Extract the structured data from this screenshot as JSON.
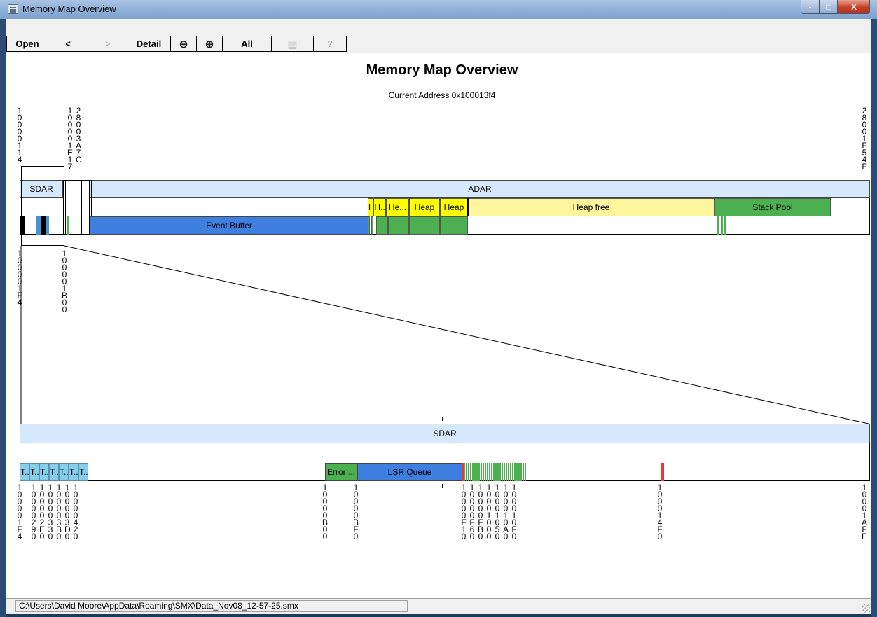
{
  "window": {
    "title": "Memory Map Overview",
    "controls": {
      "minimize": "-",
      "maximize": "□",
      "close": "X"
    }
  },
  "toolbar": {
    "buttons": [
      {
        "label": "Open",
        "icon": "",
        "enabled": true
      },
      {
        "label": "<",
        "icon": "",
        "enabled": true
      },
      {
        "label": ">",
        "icon": "",
        "enabled": false
      },
      {
        "label": "Detail",
        "icon": "",
        "enabled": true
      },
      {
        "label": "",
        "icon": "zoom-out-icon",
        "enabled": true
      },
      {
        "label": "",
        "icon": "zoom-in-icon",
        "enabled": true
      },
      {
        "label": "All",
        "icon": "",
        "enabled": true
      },
      {
        "label": "",
        "icon": "document-icon",
        "enabled": false
      },
      {
        "label": "?",
        "icon": "",
        "enabled": false
      }
    ]
  },
  "overview": {
    "title": "Memory Map Overview",
    "current_address": "Current Address 0x100013f4",
    "top_addresses": [
      "10000114",
      "100001E17",
      "28003A7C",
      "28001F54F"
    ],
    "regions": [
      {
        "label": "SDAR"
      },
      {
        "label": "ADAR"
      }
    ],
    "row2_blocks": [
      {
        "label": "H",
        "color": "#ffff00"
      },
      {
        "label": "H..",
        "color": "#ffff00"
      },
      {
        "label": "He...",
        "color": "#ffff00"
      },
      {
        "label": "Heap",
        "color": "#ffff00"
      },
      {
        "label": "Heap",
        "color": "#ffff00"
      },
      {
        "label": "Heap free",
        "color": "#fff59d"
      },
      {
        "label": "Stack Pool",
        "color": "#4caf50"
      }
    ],
    "row3_blocks": [
      {
        "label": "Event Buffer",
        "color": "#3f7fe0"
      }
    ],
    "zoom_addresses": [
      "100001F4",
      "100001B00"
    ]
  },
  "detail": {
    "region_label": "SDAR",
    "tasks": [
      "T...",
      "T...",
      "T...",
      "T...",
      "T...",
      "T...",
      "T..."
    ],
    "blocks": [
      {
        "label": "Error ...",
        "color": "#4caf50"
      },
      {
        "label": "LSR Queue",
        "color": "#3f7fe0"
      }
    ],
    "bottom_addresses": [
      "100001F4",
      "10000290",
      "100002E0",
      "10000330",
      "100003B0",
      "100003D0",
      "10000420",
      "10000B00",
      "10000BF0",
      "10000F10",
      "10000F60",
      "10000FB0",
      "10001000",
      "10001050",
      "100010A0",
      "100010F0",
      "100014F0",
      "10001AFE"
    ]
  },
  "status": {
    "path": "C:\\Users\\David Moore\\AppData\\Roaming\\SMX\\Data_Nov08_12-57-25.smx"
  },
  "colors": {
    "region_band": "#d6e8fb",
    "heap": "#ffff00",
    "heap_free": "#fff59d",
    "stack": "#4caf50",
    "buffer": "#3f7fe0",
    "task": "#87ceeb",
    "marker_red": "#e53935"
  }
}
